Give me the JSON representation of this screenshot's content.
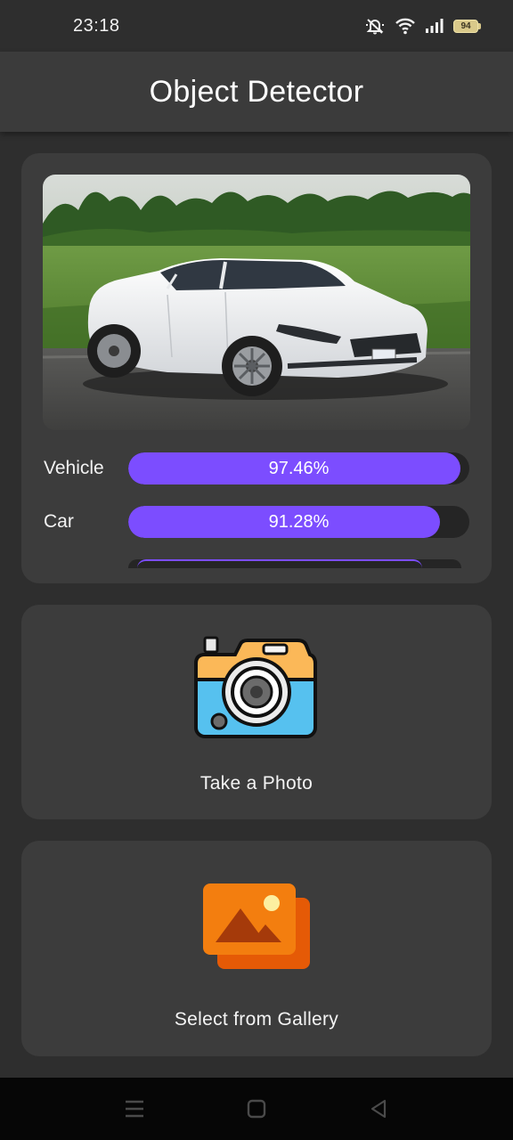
{
  "status_bar": {
    "time": "23:18",
    "icons": [
      "mute-icon",
      "wifi-icon",
      "signal-icon",
      "battery-icon"
    ],
    "battery_level": "94"
  },
  "app_bar": {
    "title": "Object Detector"
  },
  "result_card": {
    "image_description": "white sedan car parked on grass field",
    "results": [
      {
        "label": "Vehicle",
        "value_text": "97.46%",
        "fraction": 0.9746
      },
      {
        "label": "Car",
        "value_text": "91.28%",
        "fraction": 0.9128
      }
    ],
    "accent_color": "#7c4dff",
    "track_color": "#252525"
  },
  "camera_card": {
    "label": "Take a Photo",
    "icon": "camera-icon"
  },
  "gallery_card": {
    "label": "Select from Gallery",
    "icon": "gallery-icon"
  },
  "nav_bar": {
    "icons": [
      "menu-icon",
      "home-icon",
      "back-icon"
    ]
  }
}
